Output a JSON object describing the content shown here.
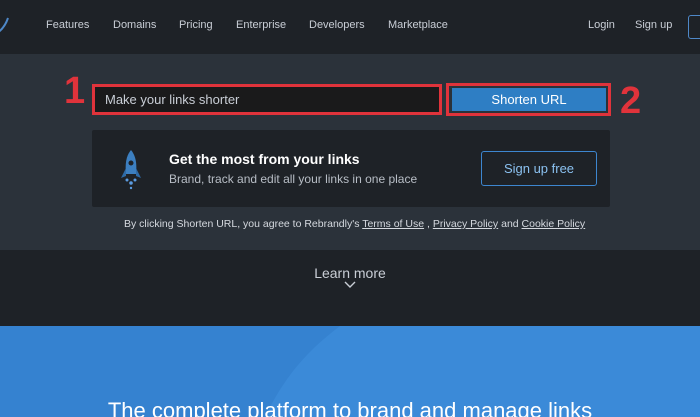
{
  "nav": {
    "items": [
      "Features",
      "Domains",
      "Pricing",
      "Enterprise",
      "Developers",
      "Marketplace"
    ],
    "login": "Login",
    "signup": "Sign up"
  },
  "shortener": {
    "placeholder": "Make your links shorter",
    "button_label": "Shorten URL"
  },
  "annotations": {
    "one": "1",
    "two": "2",
    "color": "#e0333b"
  },
  "promo": {
    "icon": "rocket-icon",
    "title": "Get the most from your links",
    "subtitle": "Brand, track and edit all your links in one place",
    "cta": "Sign up free"
  },
  "legal": {
    "prefix": "By clicking Shorten URL, you agree to Rebrandly's",
    "terms": "Terms of Use",
    "sep": " , ",
    "privacy": "Privacy Policy",
    "and": " and ",
    "cookie": "Cookie Policy"
  },
  "learn_more": {
    "label": "Learn more",
    "icon": "chevron-down-icon"
  },
  "banner": {
    "title": "The complete platform to brand and manage links"
  },
  "colors": {
    "nav_bg": "#1e2227",
    "hero_bg": "#2b323a",
    "accent_blue": "#2e7ec4",
    "banner_blue": "#3b8ad8"
  }
}
